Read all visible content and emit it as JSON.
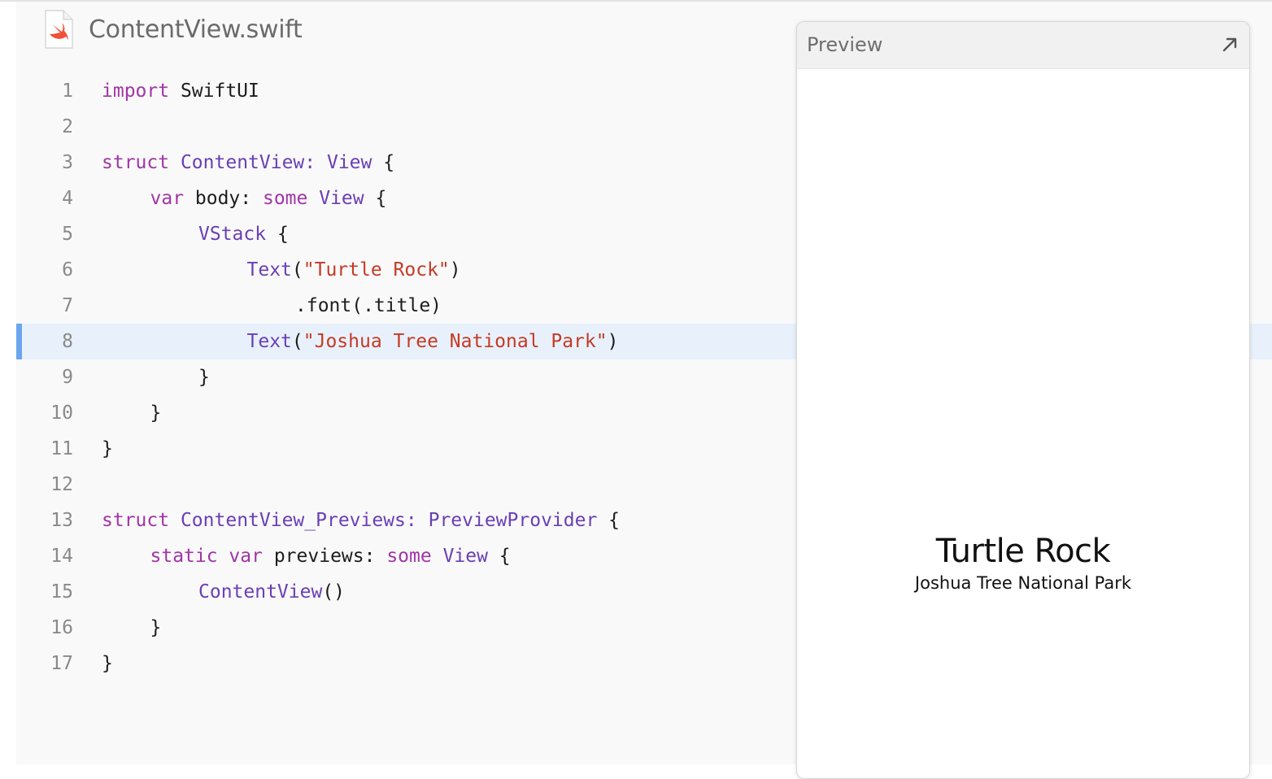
{
  "file": {
    "name": "ContentView.swift",
    "icon": "swift-file-icon"
  },
  "code": {
    "active_line": 8,
    "lines": [
      {
        "n": "1",
        "indent": 0,
        "tokens": [
          {
            "c": "kw",
            "t": "import"
          },
          {
            "c": "",
            "t": " SwiftUI"
          }
        ]
      },
      {
        "n": "2",
        "indent": 0,
        "tokens": []
      },
      {
        "n": "3",
        "indent": 0,
        "tokens": [
          {
            "c": "kw",
            "t": "struct"
          },
          {
            "c": "",
            "t": " "
          },
          {
            "c": "ty",
            "t": "ContentView: View"
          },
          {
            "c": "",
            "t": " {"
          }
        ]
      },
      {
        "n": "4",
        "indent": 1,
        "tokens": [
          {
            "c": "kw",
            "t": "var"
          },
          {
            "c": "",
            "t": " body: "
          },
          {
            "c": "kw",
            "t": "some"
          },
          {
            "c": "",
            "t": " "
          },
          {
            "c": "ty",
            "t": "View"
          },
          {
            "c": "",
            "t": " {"
          }
        ]
      },
      {
        "n": "5",
        "indent": 2,
        "tokens": [
          {
            "c": "ty",
            "t": "VStack"
          },
          {
            "c": "",
            "t": " {"
          }
        ]
      },
      {
        "n": "6",
        "indent": 3,
        "tokens": [
          {
            "c": "ty",
            "t": "Text"
          },
          {
            "c": "",
            "t": "("
          },
          {
            "c": "st",
            "t": "\"Turtle Rock\""
          },
          {
            "c": "",
            "t": ")"
          }
        ]
      },
      {
        "n": "7",
        "indent": 4,
        "tokens": [
          {
            "c": "",
            "t": ".font(.title)"
          }
        ]
      },
      {
        "n": "8",
        "indent": 3,
        "tokens": [
          {
            "c": "ty",
            "t": "Text"
          },
          {
            "c": "",
            "t": "("
          },
          {
            "c": "st",
            "t": "\"Joshua Tree National Park\""
          },
          {
            "c": "",
            "t": ")"
          }
        ]
      },
      {
        "n": "9",
        "indent": 2,
        "tokens": [
          {
            "c": "",
            "t": "}"
          }
        ]
      },
      {
        "n": "10",
        "indent": 1,
        "tokens": [
          {
            "c": "",
            "t": "}"
          }
        ]
      },
      {
        "n": "11",
        "indent": 0,
        "tokens": [
          {
            "c": "",
            "t": "}"
          }
        ]
      },
      {
        "n": "12",
        "indent": 0,
        "tokens": []
      },
      {
        "n": "13",
        "indent": 0,
        "tokens": [
          {
            "c": "kw",
            "t": "struct"
          },
          {
            "c": "",
            "t": " "
          },
          {
            "c": "ty",
            "t": "ContentView_Previews: PreviewProvider"
          },
          {
            "c": "",
            "t": " {"
          }
        ]
      },
      {
        "n": "14",
        "indent": 1,
        "tokens": [
          {
            "c": "kw",
            "t": "static var"
          },
          {
            "c": "",
            "t": " previews: "
          },
          {
            "c": "kw",
            "t": "some"
          },
          {
            "c": "",
            "t": " "
          },
          {
            "c": "ty",
            "t": "View"
          },
          {
            "c": "",
            "t": " {"
          }
        ]
      },
      {
        "n": "15",
        "indent": 2,
        "tokens": [
          {
            "c": "ty",
            "t": "ContentView"
          },
          {
            "c": "",
            "t": "()"
          }
        ]
      },
      {
        "n": "16",
        "indent": 1,
        "tokens": [
          {
            "c": "",
            "t": "}"
          }
        ]
      },
      {
        "n": "17",
        "indent": 0,
        "tokens": [
          {
            "c": "",
            "t": "}"
          }
        ]
      }
    ]
  },
  "preview": {
    "header": "Preview",
    "expand_icon": "expand-arrow-icon",
    "title_text": "Turtle Rock",
    "subtitle_text": "Joshua Tree National Park"
  },
  "colors": {
    "keyword": "#a036a6",
    "type": "#6a3fb5",
    "string": "#c53a25",
    "active_line_bg": "#e8f1fb",
    "active_line_marker": "#6aa5ee"
  }
}
